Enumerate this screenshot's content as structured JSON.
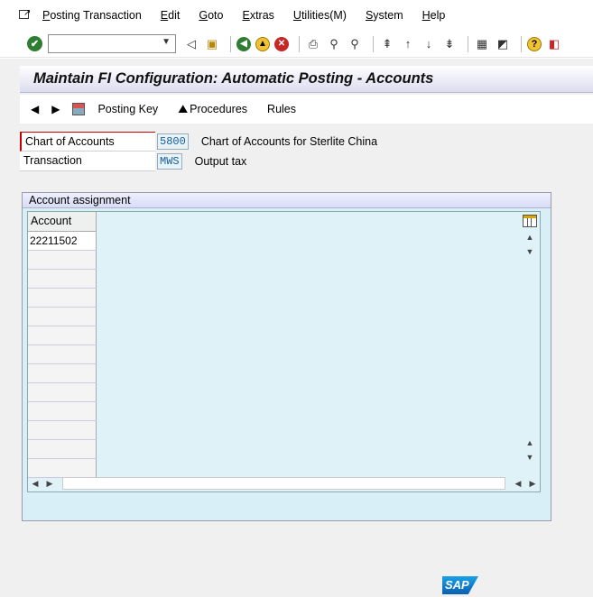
{
  "menubar": {
    "items": [
      "Posting Transaction",
      "Edit",
      "Goto",
      "Extras",
      "Utilities(M)",
      "System",
      "Help"
    ]
  },
  "toolbar": {
    "command_field_value": "",
    "icons": [
      "enter-icon",
      "back-arrow-icon",
      "save-icon",
      "back-icon",
      "exit-icon",
      "cancel-icon",
      "print-icon",
      "find-icon",
      "find-next-icon",
      "first-page-icon",
      "previous-page-icon",
      "next-page-icon",
      "last-page-icon",
      "create-session-icon",
      "shortcut-icon",
      "help-icon",
      "customize-layout-icon"
    ]
  },
  "title": "Maintain FI Configuration: Automatic Posting - Accounts",
  "app_toolbar": {
    "posting_key": "Posting Key",
    "procedures": "Procedures",
    "rules": "Rules"
  },
  "fields": {
    "chart_of_accounts": {
      "label": "Chart of Accounts",
      "value": "5800",
      "description": "Chart of Accounts for Sterlite China"
    },
    "transaction": {
      "label": "Transaction",
      "value": "MWS",
      "description": "Output tax"
    }
  },
  "account_assignment": {
    "title": "Account assignment",
    "column": "Account",
    "rows": [
      "22211502",
      "",
      "",
      "",
      "",
      "",
      "",
      "",
      "",
      "",
      "",
      "",
      ""
    ]
  },
  "colors": {
    "title_text": "#111111",
    "table_bg": "#dff2f8",
    "field_value": "#1a5a9a"
  },
  "logo": "SAP"
}
